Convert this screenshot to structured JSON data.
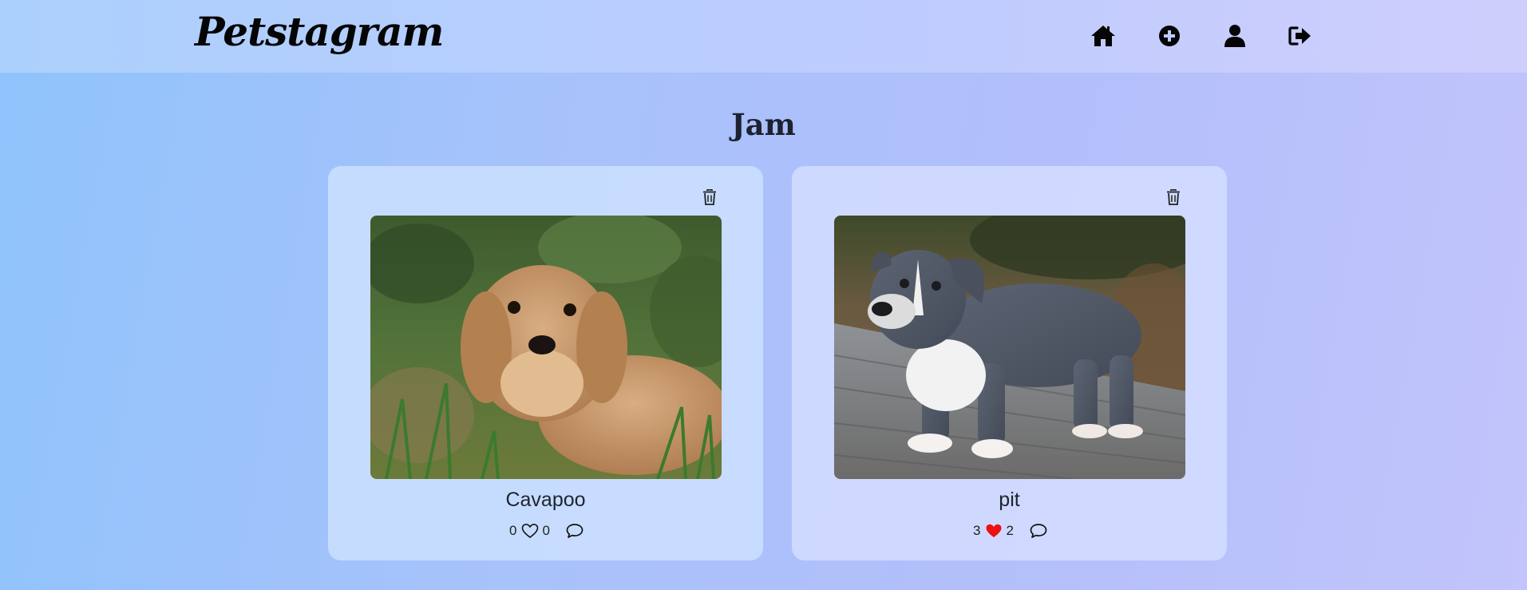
{
  "app": {
    "logo": "Petstagram"
  },
  "nav": {
    "items": [
      {
        "icon": "home-icon"
      },
      {
        "icon": "add-circle-icon"
      },
      {
        "icon": "user-icon"
      },
      {
        "icon": "logout-icon"
      }
    ]
  },
  "profile": {
    "title": "Jam"
  },
  "posts": [
    {
      "name": "Cavapoo",
      "count_left": "0",
      "count_right": "0",
      "liked": false,
      "image": "tan fluffy puppy lying in green grass",
      "icons": [
        "trash-icon",
        "heart-outline-icon",
        "comment-icon"
      ]
    },
    {
      "name": "pit",
      "count_left": "3",
      "count_right": "2",
      "liked": true,
      "image": "grey and white pit bull puppy standing on wooden deck",
      "icons": [
        "trash-icon",
        "heart-filled-icon",
        "comment-icon"
      ]
    }
  ],
  "colors": {
    "like_active": "#ee1111",
    "logo": "#050505"
  }
}
